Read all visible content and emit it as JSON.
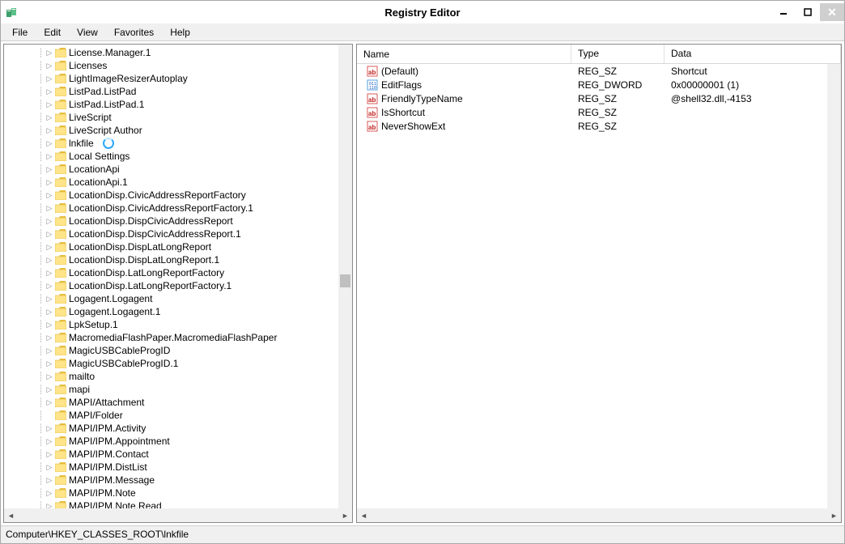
{
  "window": {
    "title": "Registry Editor"
  },
  "menu": [
    "File",
    "Edit",
    "View",
    "Favorites",
    "Help"
  ],
  "tree": {
    "items": [
      {
        "label": "License.Manager.1",
        "expandable": true
      },
      {
        "label": "Licenses",
        "expandable": true
      },
      {
        "label": "LightImageResizerAutoplay",
        "expandable": true
      },
      {
        "label": "ListPad.ListPad",
        "expandable": true
      },
      {
        "label": "ListPad.ListPad.1",
        "expandable": true
      },
      {
        "label": "LiveScript",
        "expandable": true
      },
      {
        "label": "LiveScript Author",
        "expandable": true
      },
      {
        "label": "lnkfile",
        "expandable": true,
        "busy": true
      },
      {
        "label": "Local Settings",
        "expandable": true
      },
      {
        "label": "LocationApi",
        "expandable": true
      },
      {
        "label": "LocationApi.1",
        "expandable": true
      },
      {
        "label": "LocationDisp.CivicAddressReportFactory",
        "expandable": true
      },
      {
        "label": "LocationDisp.CivicAddressReportFactory.1",
        "expandable": true
      },
      {
        "label": "LocationDisp.DispCivicAddressReport",
        "expandable": true
      },
      {
        "label": "LocationDisp.DispCivicAddressReport.1",
        "expandable": true
      },
      {
        "label": "LocationDisp.DispLatLongReport",
        "expandable": true
      },
      {
        "label": "LocationDisp.DispLatLongReport.1",
        "expandable": true
      },
      {
        "label": "LocationDisp.LatLongReportFactory",
        "expandable": true
      },
      {
        "label": "LocationDisp.LatLongReportFactory.1",
        "expandable": true
      },
      {
        "label": "Logagent.Logagent",
        "expandable": true
      },
      {
        "label": "Logagent.Logagent.1",
        "expandable": true
      },
      {
        "label": "LpkSetup.1",
        "expandable": true
      },
      {
        "label": "MacromediaFlashPaper.MacromediaFlashPaper",
        "expandable": true
      },
      {
        "label": "MagicUSBCableProgID",
        "expandable": true
      },
      {
        "label": "MagicUSBCableProgID.1",
        "expandable": true
      },
      {
        "label": "mailto",
        "expandable": true
      },
      {
        "label": "mapi",
        "expandable": true
      },
      {
        "label": "MAPI/Attachment",
        "expandable": true
      },
      {
        "label": "MAPI/Folder",
        "expandable": false
      },
      {
        "label": "MAPI/IPM.Activity",
        "expandable": true
      },
      {
        "label": "MAPI/IPM.Appointment",
        "expandable": true
      },
      {
        "label": "MAPI/IPM.Contact",
        "expandable": true
      },
      {
        "label": "MAPI/IPM.DistList",
        "expandable": true
      },
      {
        "label": "MAPI/IPM.Message",
        "expandable": true
      },
      {
        "label": "MAPI/IPM.Note",
        "expandable": true
      },
      {
        "label": "MAPI/IPM.Note.Read",
        "expandable": true
      }
    ]
  },
  "list": {
    "columns": {
      "name": "Name",
      "type": "Type",
      "data": "Data"
    },
    "rows": [
      {
        "icon": "string",
        "name": "(Default)",
        "type": "REG_SZ",
        "data": "Shortcut"
      },
      {
        "icon": "binary",
        "name": "EditFlags",
        "type": "REG_DWORD",
        "data": "0x00000001 (1)"
      },
      {
        "icon": "string",
        "name": "FriendlyTypeName",
        "type": "REG_SZ",
        "data": "@shell32.dll,-4153"
      },
      {
        "icon": "string",
        "name": "IsShortcut",
        "type": "REG_SZ",
        "data": ""
      },
      {
        "icon": "string",
        "name": "NeverShowExt",
        "type": "REG_SZ",
        "data": ""
      }
    ]
  },
  "statusbar": "Computer\\HKEY_CLASSES_ROOT\\lnkfile"
}
